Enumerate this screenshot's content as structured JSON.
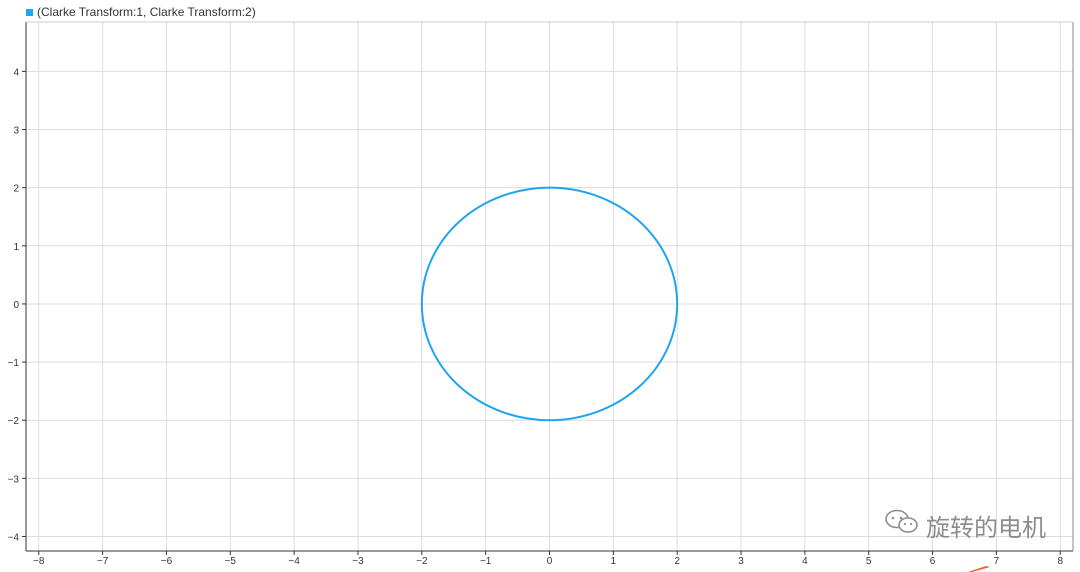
{
  "chart_data": {
    "type": "line",
    "title": "",
    "xlabel": "",
    "ylabel": "",
    "xlim": [
      -8.2,
      8.2
    ],
    "ylim": [
      -4.25,
      4.85
    ],
    "xticks": [
      -8,
      -7,
      -6,
      -5,
      -4,
      -3,
      -2,
      -1,
      0,
      1,
      2,
      3,
      4,
      5,
      6,
      7,
      8
    ],
    "yticks": [
      -4,
      -3,
      -2,
      -1,
      0,
      1,
      2,
      3,
      4
    ],
    "grid": true,
    "legend_position": "top-left",
    "series": [
      {
        "name": "(Clarke Transform:1, Clarke Transform:2)",
        "color": "#1fa4f0",
        "shape": "circle",
        "center": [
          0,
          0
        ],
        "radius": 2
      }
    ]
  },
  "legend": {
    "label": "(Clarke Transform:1, Clarke Transform:2)",
    "color": "#1fa4f0"
  },
  "watermark": {
    "text": "旋转的电机",
    "icon": "wechat-icon",
    "color": "#7a7a7a"
  },
  "colors": {
    "grid": "#dcdcdc",
    "axis": "#333333",
    "tick_label": "#333333",
    "accent": "#e8602c"
  }
}
